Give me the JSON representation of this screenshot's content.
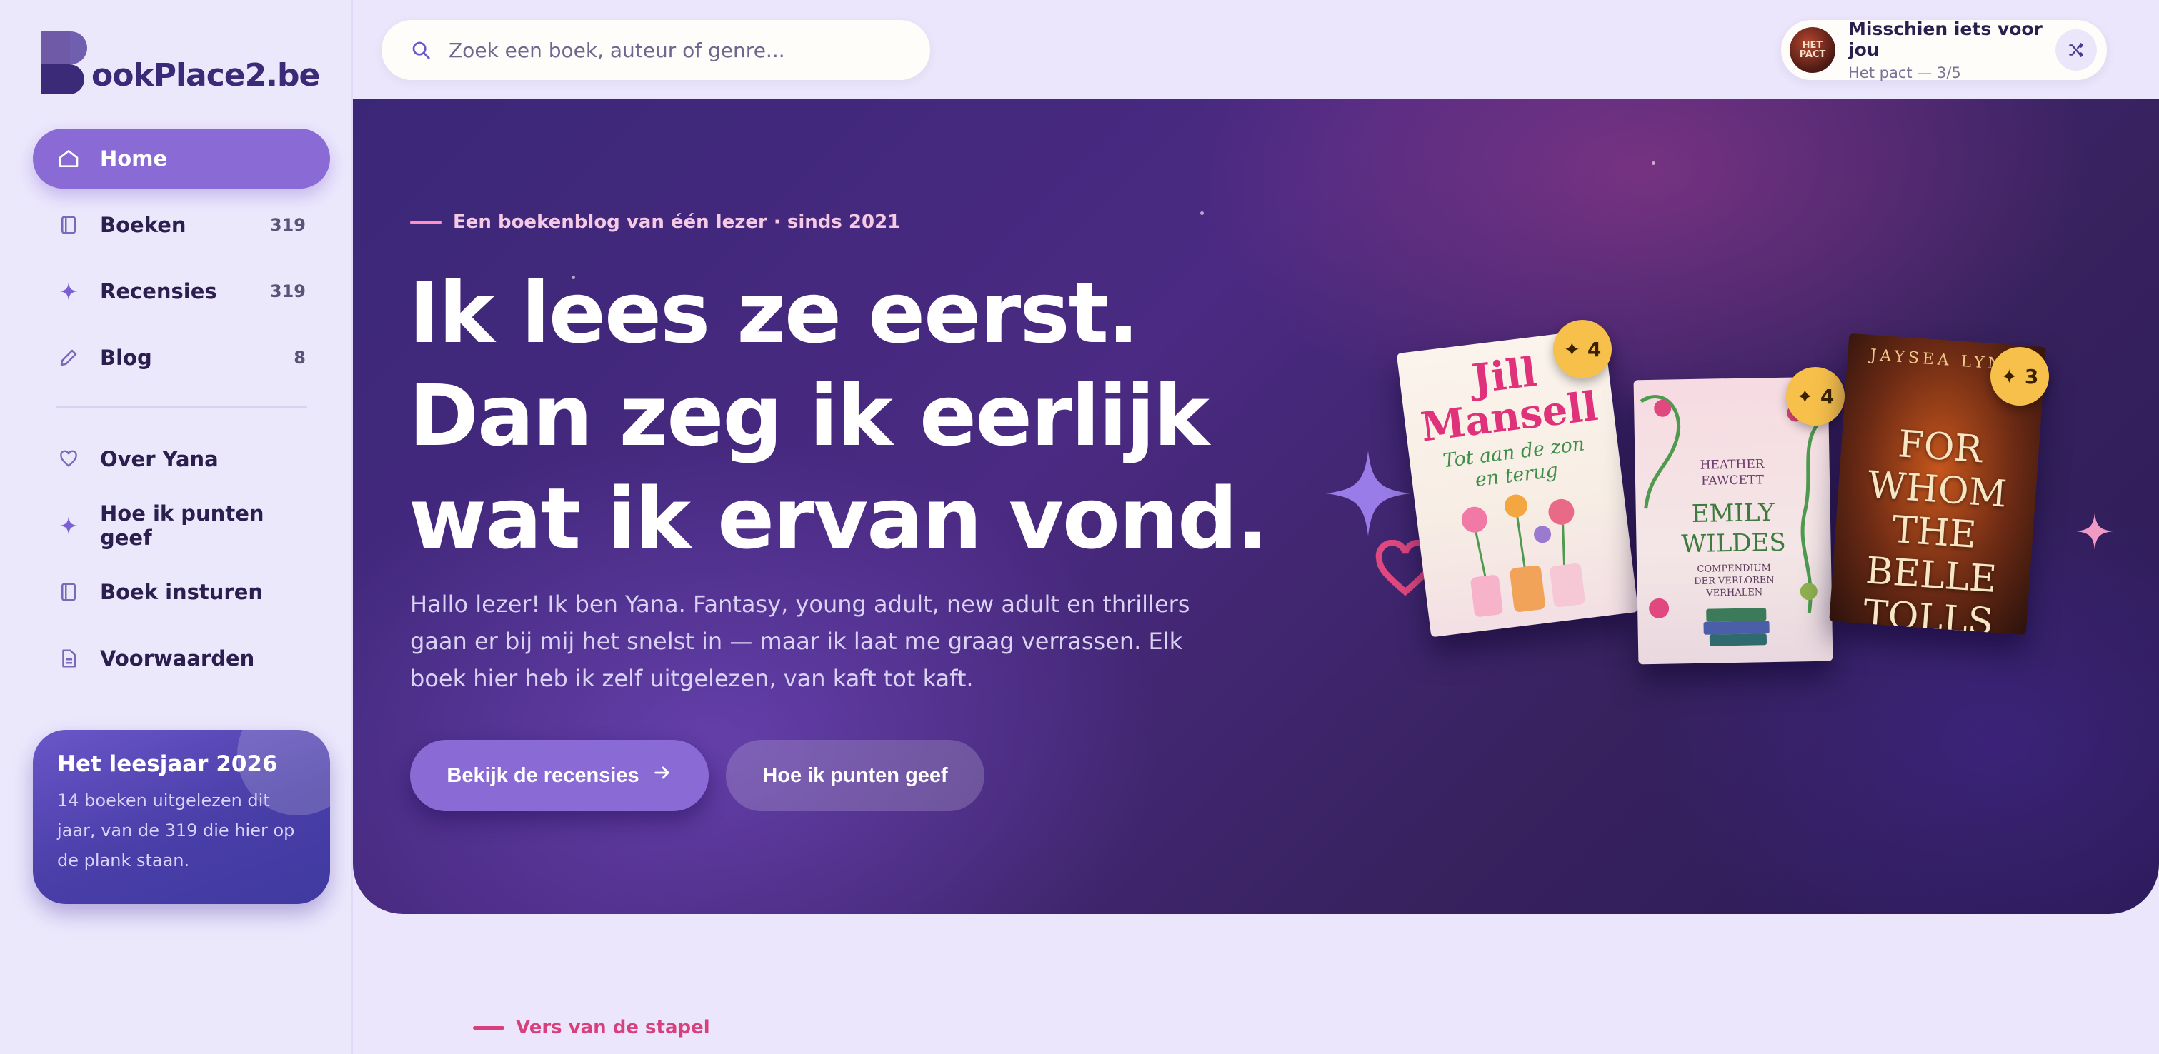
{
  "brand": {
    "logo_text": "ookPlace2.be",
    "colors": {
      "accent": "#8a6ad4",
      "deep": "#3a2a78",
      "pink": "#d8407d",
      "gold": "#f7c04a"
    }
  },
  "sidebar": {
    "items": [
      {
        "label": "Home",
        "icon": "home-icon",
        "count": ""
      },
      {
        "label": "Boeken",
        "icon": "book-icon",
        "count": "319"
      },
      {
        "label": "Recensies",
        "icon": "sparkle-icon",
        "count": "319"
      },
      {
        "label": "Blog",
        "icon": "pencil-icon",
        "count": "8"
      }
    ],
    "secondary": [
      {
        "label": "Over Yana",
        "icon": "heart-icon"
      },
      {
        "label": "Hoe ik punten geef",
        "icon": "sparkle-icon"
      },
      {
        "label": "Boek insturen",
        "icon": "book-icon"
      },
      {
        "label": "Voorwaarden",
        "icon": "document-icon"
      }
    ],
    "year_card": {
      "title": "Het leesjaar 2026",
      "text": "14 boeken uitgelezen dit jaar, van de 319 die hier op de plank staan."
    }
  },
  "search": {
    "placeholder": "Zoek een boek, auteur of genre..."
  },
  "suggestion": {
    "title": "Misschien iets voor jou",
    "subtitle": "Het pact — 3/5",
    "avatar_text": "HET PACT",
    "icon": "shuffle-icon"
  },
  "hero": {
    "eyebrow": "Een boekenblog van één lezer · sinds 2021",
    "headline_pre": "Ik lees ze eerst. Dan zeg ik ",
    "headline_highlight": "eerlijk",
    "headline_post": " wat ik ervan vond.",
    "intro": "Hallo lezer! Ik ben Yana. Fantasy, young adult, new adult en thrillers gaan er bij mij het snelst in — maar ik laat me graag verrassen. Elk boek hier heb ik zelf uitgelezen, van kaft tot kaft.",
    "primary_button": "Bekijk de recensies",
    "secondary_button": "Hoe ik punten geef",
    "books": [
      {
        "author": "Jill Mansell",
        "title": "Tot aan de zon en terug",
        "rating": "✦ 4"
      },
      {
        "author": "HEATHER FAWCETT",
        "title": "EMILY WILDES",
        "subtitle": "COMPENDIUM DER VERLOREN VERHALEN",
        "rating": "✦ 4"
      },
      {
        "author": "JAYSEA LYNN",
        "title": "FOR WHOM THE BELLE TOLLS",
        "rating": "✦ 3"
      }
    ]
  },
  "section": {
    "label": "Vers van de stapel"
  }
}
